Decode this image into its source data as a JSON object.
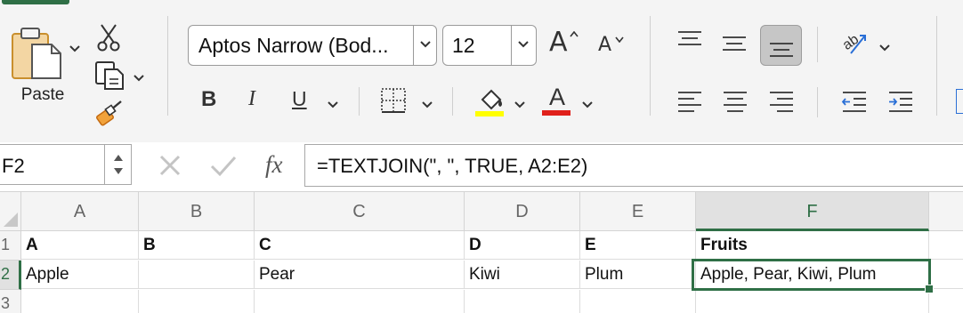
{
  "ribbon": {
    "paste_label": "Paste",
    "font_name": "Aptos Narrow (Bod...",
    "font_size": "12",
    "grow_font_letter": "A",
    "shrink_font_letter": "A",
    "bold_label": "B",
    "italic_label": "I",
    "underline_label": "U",
    "font_color_letter": "A",
    "highlight_color": "#ffff00",
    "font_color": "#e0201b"
  },
  "formula_bar": {
    "name_box": "F2",
    "fx_label": "fx",
    "formula": "=TEXTJOIN(\", \", TRUE, A2:E2)"
  },
  "sheet": {
    "columns": [
      "A",
      "B",
      "C",
      "D",
      "E",
      "F"
    ],
    "row_numbers": [
      "1",
      "2",
      "3"
    ],
    "rows": [
      [
        "A",
        "B",
        "C",
        "D",
        "E",
        "Fruits"
      ],
      [
        "Apple",
        "",
        "Pear",
        "Kiwi",
        "Plum",
        "Apple, Pear, Kiwi, Plum"
      ],
      [
        "",
        "",
        "",
        "",
        "",
        ""
      ]
    ],
    "active_cell": "F2",
    "accent_color": "#2f6f46"
  }
}
